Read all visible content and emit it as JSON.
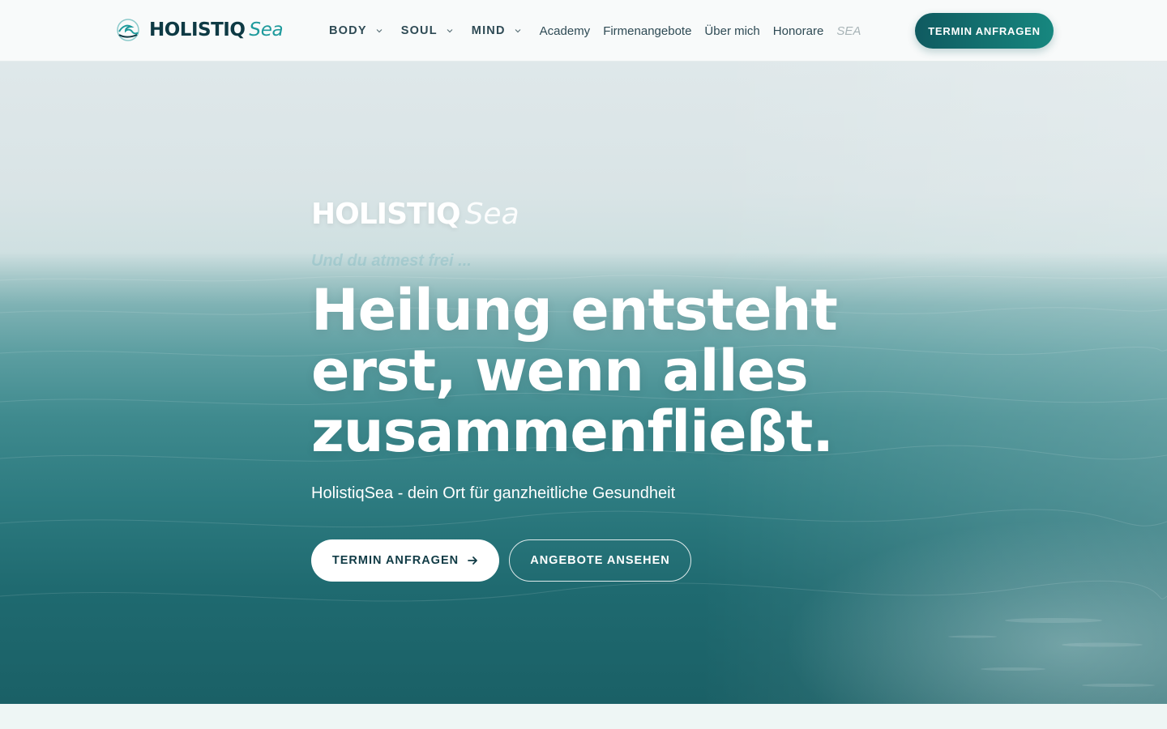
{
  "header": {
    "logo": {
      "bold": "HOLISTIQ",
      "italic": "Sea",
      "mark_icon": "wave-logo-icon"
    },
    "nav": [
      {
        "label": "BODY",
        "dropdown": true
      },
      {
        "label": "SOUL",
        "dropdown": true
      },
      {
        "label": "MIND",
        "dropdown": true
      },
      {
        "label": "Academy",
        "dropdown": false
      },
      {
        "label": "Firmenangebote",
        "dropdown": false
      },
      {
        "label": "Über mich",
        "dropdown": false
      },
      {
        "label": "Honorare",
        "dropdown": false
      },
      {
        "label": "SEA",
        "dropdown": false,
        "faded": true
      }
    ],
    "cta_label": "TERMIN ANFRAGEN"
  },
  "hero": {
    "logo": {
      "bold": "HOLISTIQ",
      "italic": "Sea"
    },
    "tagline": "Und du atmest frei ...",
    "headline_lines": [
      "Heilung entsteht",
      "erst, wenn alles",
      "zusammenfließt."
    ],
    "subline": "HolistiqSea - dein Ort für ganzheitliche Gesundheit",
    "primary_button": "TERMIN ANFRAGEN",
    "secondary_button": "ANGEBOTE ANSEHEN"
  },
  "colors": {
    "brand_dark": "#0e3a44",
    "brand_teal": "#1e9a9c",
    "cta_gradient_start": "#0f5a60",
    "cta_gradient_end": "#17877f"
  }
}
